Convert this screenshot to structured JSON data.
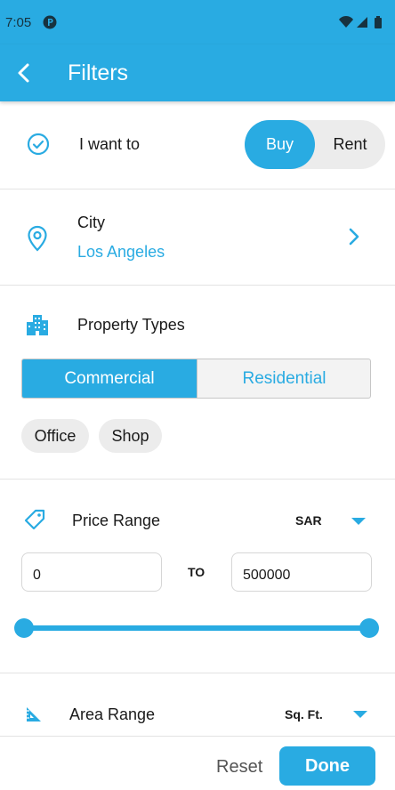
{
  "status_bar": {
    "time": "7:05",
    "app_notification_icon": "p-circle-icon",
    "system_icons": [
      "wifi-icon",
      "signal-icon",
      "battery-icon"
    ]
  },
  "app_bar": {
    "title": "Filters",
    "back_icon": "back-arrow-icon"
  },
  "intent": {
    "label": "I want to",
    "icon": "check-circle-icon",
    "options": [
      "Buy",
      "Rent"
    ],
    "selected": "Buy"
  },
  "city": {
    "label": "City",
    "value": "Los Angeles",
    "icon": "location-pin-icon",
    "chevron": "chevron-right-icon"
  },
  "property_types": {
    "label": "Property Types",
    "icon": "buildings-icon",
    "categories": [
      "Commercial",
      "Residential"
    ],
    "selected_category": "Commercial",
    "chips": [
      "Office",
      "Shop"
    ]
  },
  "price_range": {
    "label": "Price Range",
    "icon": "tag-icon",
    "currency": "SAR",
    "min": "0",
    "to_label": "TO",
    "max": "500000",
    "slider_min_fraction": 0,
    "slider_max_fraction": 1
  },
  "area_range": {
    "label": "Area Range",
    "icon": "set-square-icon",
    "unit": "Sq. Ft."
  },
  "footer": {
    "reset_label": "Reset",
    "done_label": "Done"
  },
  "colors": {
    "primary": "#29abe2",
    "chip_bg": "#ececec",
    "divider": "#e3e3e3"
  }
}
